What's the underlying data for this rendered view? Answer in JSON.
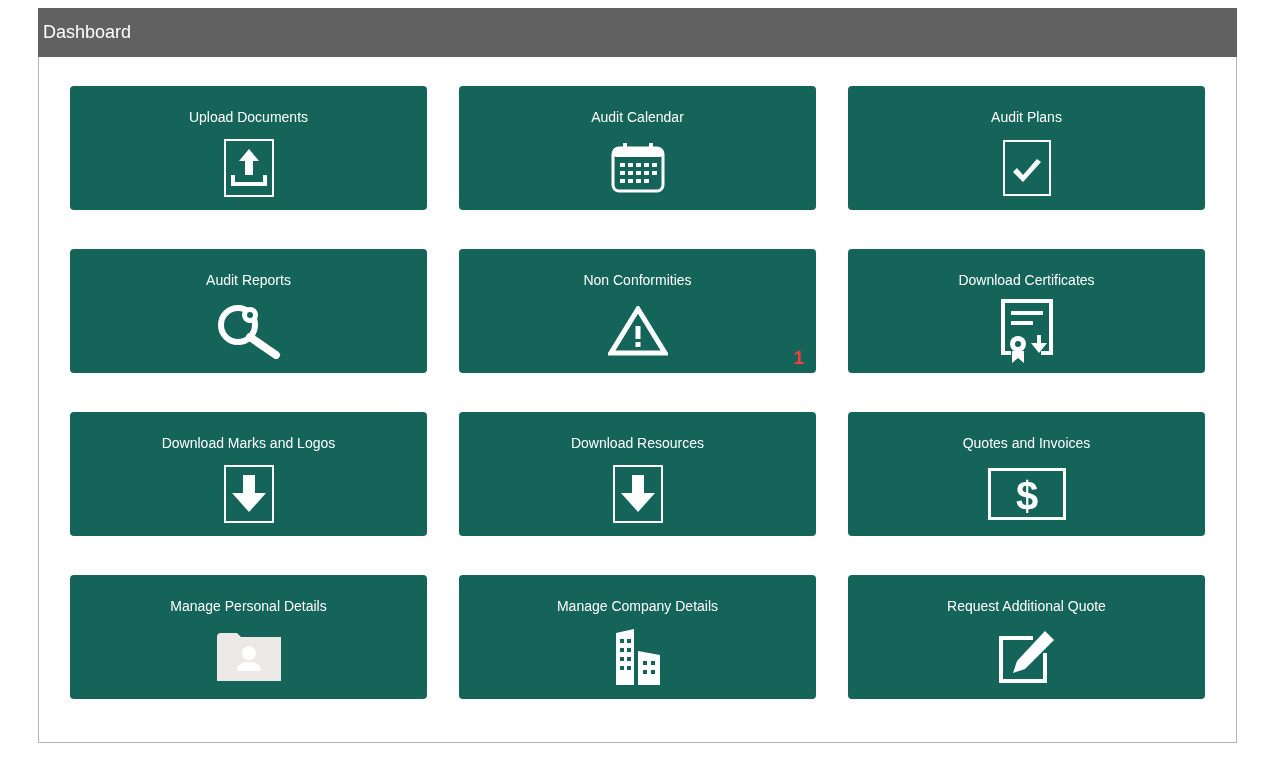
{
  "header": {
    "title": "Dashboard"
  },
  "tiles": [
    {
      "label": "Upload Documents",
      "kind": "upload"
    },
    {
      "label": "Audit Calendar",
      "kind": "calendar"
    },
    {
      "label": "Audit Plans",
      "kind": "check"
    },
    {
      "label": "Audit Reports",
      "kind": "search"
    },
    {
      "label": "Non Conformities",
      "kind": "warning",
      "badge": "1"
    },
    {
      "label": "Download Certificates",
      "kind": "certificate"
    },
    {
      "label": "Download Marks and Logos",
      "kind": "download"
    },
    {
      "label": "Download Resources",
      "kind": "download"
    },
    {
      "label": "Quotes and Invoices",
      "kind": "dollar",
      "glyph": "$"
    },
    {
      "label": "Manage Personal Details",
      "kind": "folder"
    },
    {
      "label": "Manage Company Details",
      "kind": "building"
    },
    {
      "label": "Request Additional Quote",
      "kind": "edit"
    }
  ]
}
